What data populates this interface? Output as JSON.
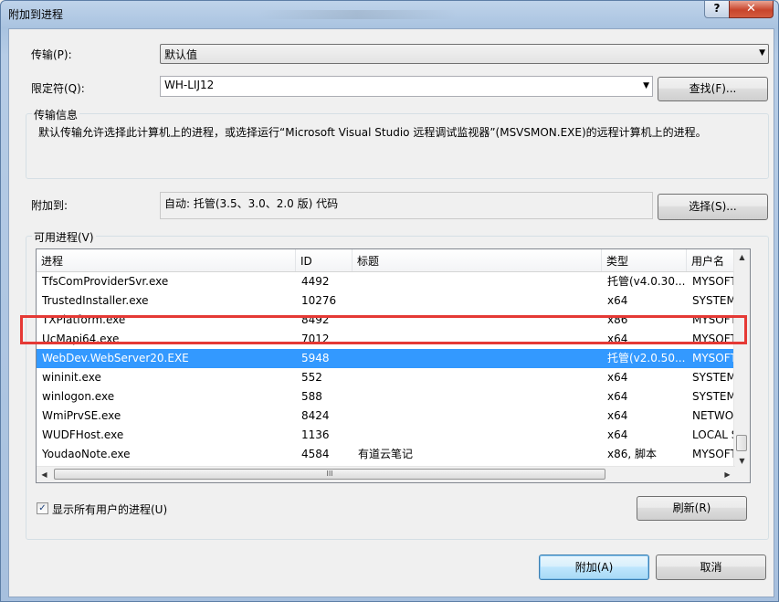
{
  "window": {
    "title": "附加到进程",
    "help": "?",
    "close": "✕"
  },
  "transport": {
    "label": "传输(P):",
    "value": "默认值"
  },
  "qualifier": {
    "label": "限定符(Q):",
    "value": "WH-LIJ12",
    "find_button": "查找(F)..."
  },
  "transport_info": {
    "label": "传输信息",
    "text": "默认传输允许选择此计算机上的进程，或选择运行“Microsoft Visual Studio 远程调试监视器”(MSVSMON.EXE)的远程计算机上的进程。"
  },
  "attach_to": {
    "label": "附加到:",
    "value": "自动: 托管(3.5、3.0、2.0 版) 代码",
    "select_button": "选择(S)..."
  },
  "available_processes": {
    "label": "可用进程(V)",
    "columns": [
      "进程",
      "ID",
      "标题",
      "类型",
      "用户名"
    ],
    "rows": [
      [
        "TfsComProviderSvr.exe",
        "4492",
        "",
        "托管(v4.0.30...",
        "MYSOFT"
      ],
      [
        "TrustedInstaller.exe",
        "10276",
        "",
        "x64",
        "SYSTEM"
      ],
      [
        "TXPlatform.exe",
        "8492",
        "",
        "x86",
        "MYSOFT"
      ],
      [
        "UcMapi64.exe",
        "7012",
        "",
        "x64",
        "MYSOFT"
      ],
      [
        "WebDev.WebServer20.EXE",
        "5948",
        "",
        "托管(v2.0.50...",
        "MYSOFT"
      ],
      [
        "wininit.exe",
        "552",
        "",
        "x64",
        "SYSTEM"
      ],
      [
        "winlogon.exe",
        "588",
        "",
        "x64",
        "SYSTEM"
      ],
      [
        "WmiPrvSE.exe",
        "8424",
        "",
        "x64",
        "NETWO"
      ],
      [
        "WUDFHost.exe",
        "1136",
        "",
        "x64",
        "LOCAL S"
      ],
      [
        "YoudaoNote.exe",
        "4584",
        "有道云笔记",
        "x86, 脚本",
        "MYSOFT"
      ]
    ],
    "selected_row": "WebDev.WebServer20.EXE",
    "hscroll_grip": "III"
  },
  "show_all_users": {
    "label": "显示所有用户的进程(U)",
    "checked": true,
    "check_glyph": "✓"
  },
  "refresh_button": "刷新(R)",
  "attach_button": "附加(A)",
  "cancel_button": "取消",
  "colors": {
    "selection": "#3399ff",
    "highlight_box": "#e53935",
    "close": "#c8452c"
  }
}
